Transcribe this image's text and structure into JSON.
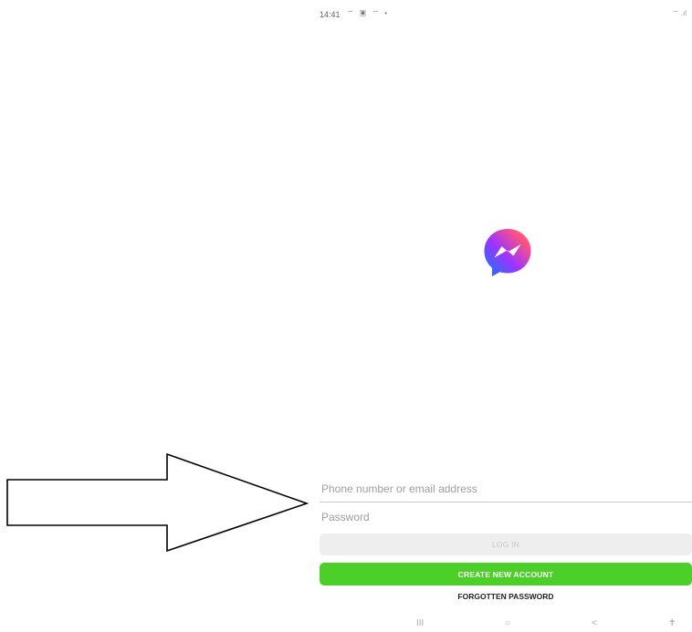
{
  "status_bar": {
    "time": "14:41",
    "icons": "⌔ ▣ ⌔ •",
    "right_icons": "⌔ .ıl"
  },
  "logo": {
    "name": "messenger-logo"
  },
  "login": {
    "phone_placeholder": "Phone number or email address",
    "password_placeholder": "Password",
    "login_label": "LOG IN",
    "create_account_label": "CREATE NEW ACCOUNT",
    "forgot_label": "FORGOTTEN PASSWORD"
  },
  "nav": {
    "recents": "III",
    "home": "○",
    "back": "<",
    "accessibility": "✝"
  },
  "colors": {
    "create_button": "#4ccf28",
    "login_button_disabled": "#eeeeee"
  }
}
